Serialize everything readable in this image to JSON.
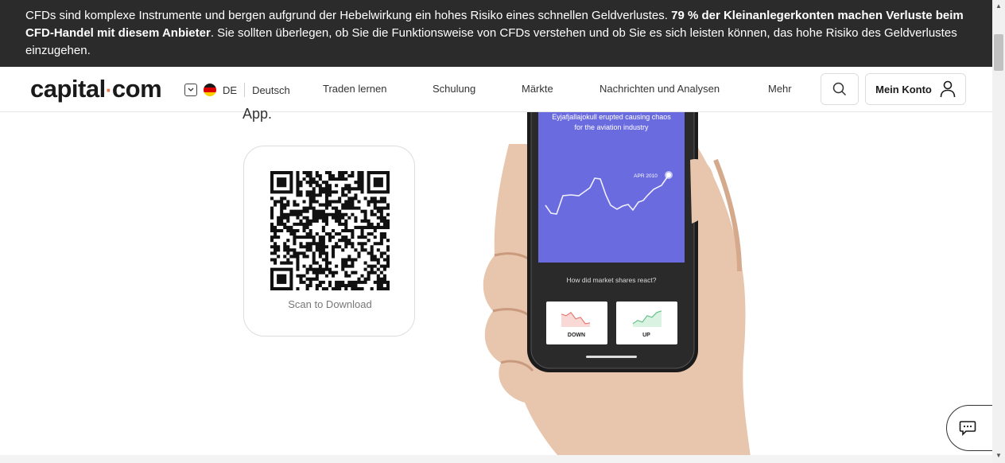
{
  "risk_banner": {
    "text_1": "CFDs sind komplexe Instrumente und bergen aufgrund der Hebelwirkung ein hohes Risiko eines schnellen Geldverlustes. ",
    "text_bold": "79 % der Kleinanlegerkonten machen Verluste beim CFD-Handel mit diesem Anbieter",
    "text_2": ". Sie sollten überlegen, ob Sie die Funktionsweise von CFDs verstehen und ob Sie es sich leisten können, das hohe Risiko des Geldverlustes einzugehen."
  },
  "header": {
    "logo_left": "capital",
    "logo_dot": "·",
    "logo_right": "com",
    "lang_code": "DE",
    "lang_name": "Deutsch",
    "nav": [
      "Traden lernen",
      "Schulung",
      "Märkte",
      "Nachrichten und Analysen",
      "Mehr"
    ],
    "account_label": "Mein Konto"
  },
  "main": {
    "app_text": "App.",
    "qr_caption": "Scan to Download"
  },
  "phone": {
    "headline_1": "Eyjafjallajokull erupted causing chaos",
    "headline_2": "for the aviation industry",
    "chart_tag": "APR 2010",
    "question": "How did market shares react?",
    "down_label": "DOWN",
    "up_label": "UP"
  },
  "colors": {
    "banner_bg": "#2b2b2b",
    "logo_accent": "#e07c4f",
    "phone_screen": "#6b6be0",
    "down_red": "#e05a4f",
    "up_green": "#3fae6a"
  },
  "icons": [
    "chevron-down-icon",
    "german-flag-icon",
    "search-icon",
    "user-icon",
    "chat-icon",
    "qr-code"
  ]
}
